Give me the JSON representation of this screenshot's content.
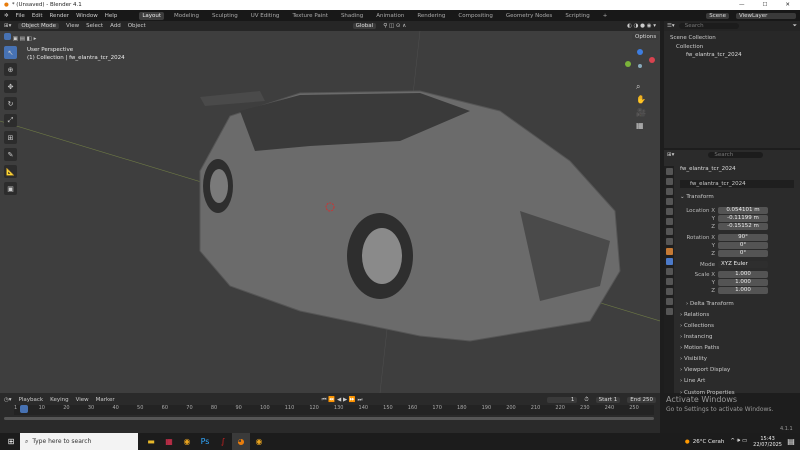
{
  "window": {
    "title": "* (Unsaved) - Blender 4.1"
  },
  "menu": [
    "File",
    "Edit",
    "Render",
    "Window",
    "Help"
  ],
  "workspaces": [
    "Layout",
    "Modeling",
    "Sculpting",
    "UV Editing",
    "Texture Paint",
    "Shading",
    "Animation",
    "Rendering",
    "Compositing",
    "Geometry Nodes",
    "Scripting",
    "+"
  ],
  "scene": "Scene",
  "view_layer": "ViewLayer",
  "viewport": {
    "mode": "Object Mode",
    "menu": [
      "View",
      "Select",
      "Add",
      "Object"
    ],
    "orientation": "Global",
    "options": "Options",
    "overlay_line1": "User Perspective",
    "overlay_line2": "(1) Collection | fw_elantra_tcr_2024"
  },
  "outliner": {
    "search_placeholder": "Search",
    "items": [
      "Scene Collection",
      "Collection",
      "fw_elantra_tcr_2024"
    ]
  },
  "properties": {
    "search_placeholder": "Search",
    "object_name": "fw_elantra_tcr_2024",
    "data_name": "fw_elantra_tcr_2024",
    "transform_label": "Transform",
    "location": {
      "label": "Location X",
      "x": "0.054101 m",
      "y": "-0.11199 m",
      "z": "-0.15152 m"
    },
    "rotation": {
      "label": "Rotation X",
      "x": "90°",
      "y": "0°",
      "z": "0°"
    },
    "mode": {
      "label": "Mode",
      "value": "XYZ Euler"
    },
    "scale": {
      "label": "Scale X",
      "x": "1.000",
      "y": "1.000",
      "z": "1.000"
    },
    "axis_y": "Y",
    "axis_z": "Z",
    "sections": [
      "Delta Transform",
      "Relations",
      "Collections",
      "Instancing",
      "Motion Paths",
      "Visibility",
      "Viewport Display",
      "Line Art",
      "Custom Properties"
    ]
  },
  "timeline": {
    "menu": [
      "Playback",
      "Keying",
      "View",
      "Marker"
    ],
    "current_frame": "1",
    "start_label": "Start",
    "start": "1",
    "end_label": "End",
    "end": "250",
    "ticks": [
      "1",
      "10",
      "20",
      "30",
      "40",
      "50",
      "60",
      "70",
      "80",
      "90",
      "100",
      "110",
      "120",
      "130",
      "140",
      "150",
      "160",
      "170",
      "180",
      "190",
      "200",
      "210",
      "220",
      "230",
      "240",
      "250"
    ]
  },
  "watermark": {
    "title": "Activate Windows",
    "subtitle": "Go to Settings to activate Windows."
  },
  "version": "4.1.1",
  "taskbar": {
    "search_placeholder": "Type here to search",
    "weather": "26°C  Cerah",
    "time": "15:43",
    "date": "22/07/2025"
  }
}
